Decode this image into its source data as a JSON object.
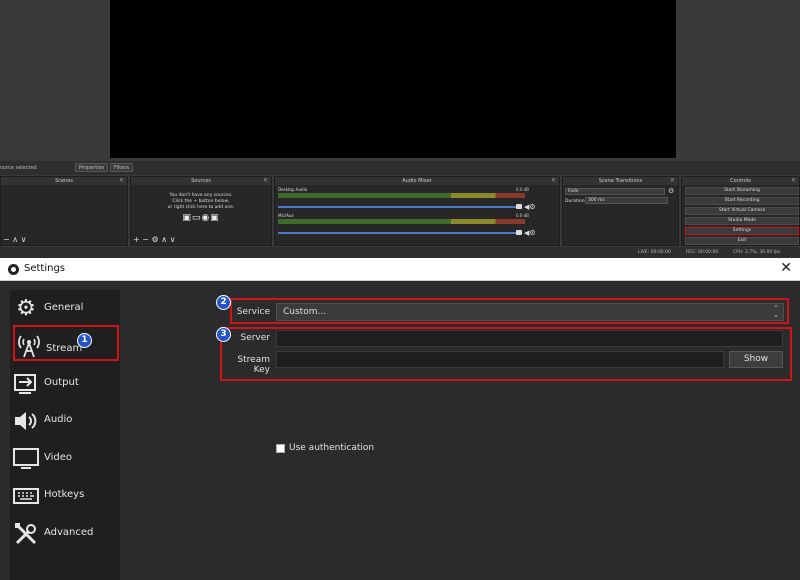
{
  "obs": {
    "source_bar": {
      "no_source": "ource selected",
      "properties": "Properties",
      "filters": "Filters"
    },
    "docks": {
      "scenes": "Scenes",
      "sources": "Sources",
      "audio_mixer": "Audio Mixer",
      "scene_transitions": "Scene Transitions",
      "controls": "Controls"
    },
    "sources_hint": [
      "You don't have any sources.",
      "Click the + button below,",
      "or right click here to add one."
    ],
    "mixer": [
      {
        "name": "Desktop Audio",
        "db": "0.0 dB"
      },
      {
        "name": "Mic/Aux",
        "db": "0.0 dB"
      }
    ],
    "transitions": {
      "type": "Fade",
      "duration_label": "Duration",
      "duration_value": "300 ms"
    },
    "controls": [
      "Start Streaming",
      "Start Recording",
      "Start Virtual Camera",
      "Studio Mode",
      "Settings",
      "Exit"
    ],
    "status": {
      "live": "LIVE: 00:00:00",
      "rec": "REC: 00:00:00",
      "cpu": "CPU: 2.7%, 30.00 fps"
    }
  },
  "settings": {
    "title": "Settings",
    "sidebar": [
      {
        "label": "General",
        "icon": "gear-icon"
      },
      {
        "label": "Stream",
        "icon": "antenna-icon"
      },
      {
        "label": "Output",
        "icon": "output-icon"
      },
      {
        "label": "Audio",
        "icon": "speaker-icon"
      },
      {
        "label": "Video",
        "icon": "monitor-icon"
      },
      {
        "label": "Hotkeys",
        "icon": "keyboard-icon"
      },
      {
        "label": "Advanced",
        "icon": "tools-icon"
      }
    ],
    "badges": [
      "1",
      "2",
      "3"
    ],
    "service": {
      "label": "Service",
      "value": "Custom..."
    },
    "server": {
      "label": "Server",
      "value": ""
    },
    "stream_key": {
      "label": "Stream Key",
      "value": "",
      "show_button": "Show"
    },
    "use_auth": "Use authentication"
  },
  "colors": {
    "highlight": "#d0121b",
    "badge": "#2456c8"
  }
}
